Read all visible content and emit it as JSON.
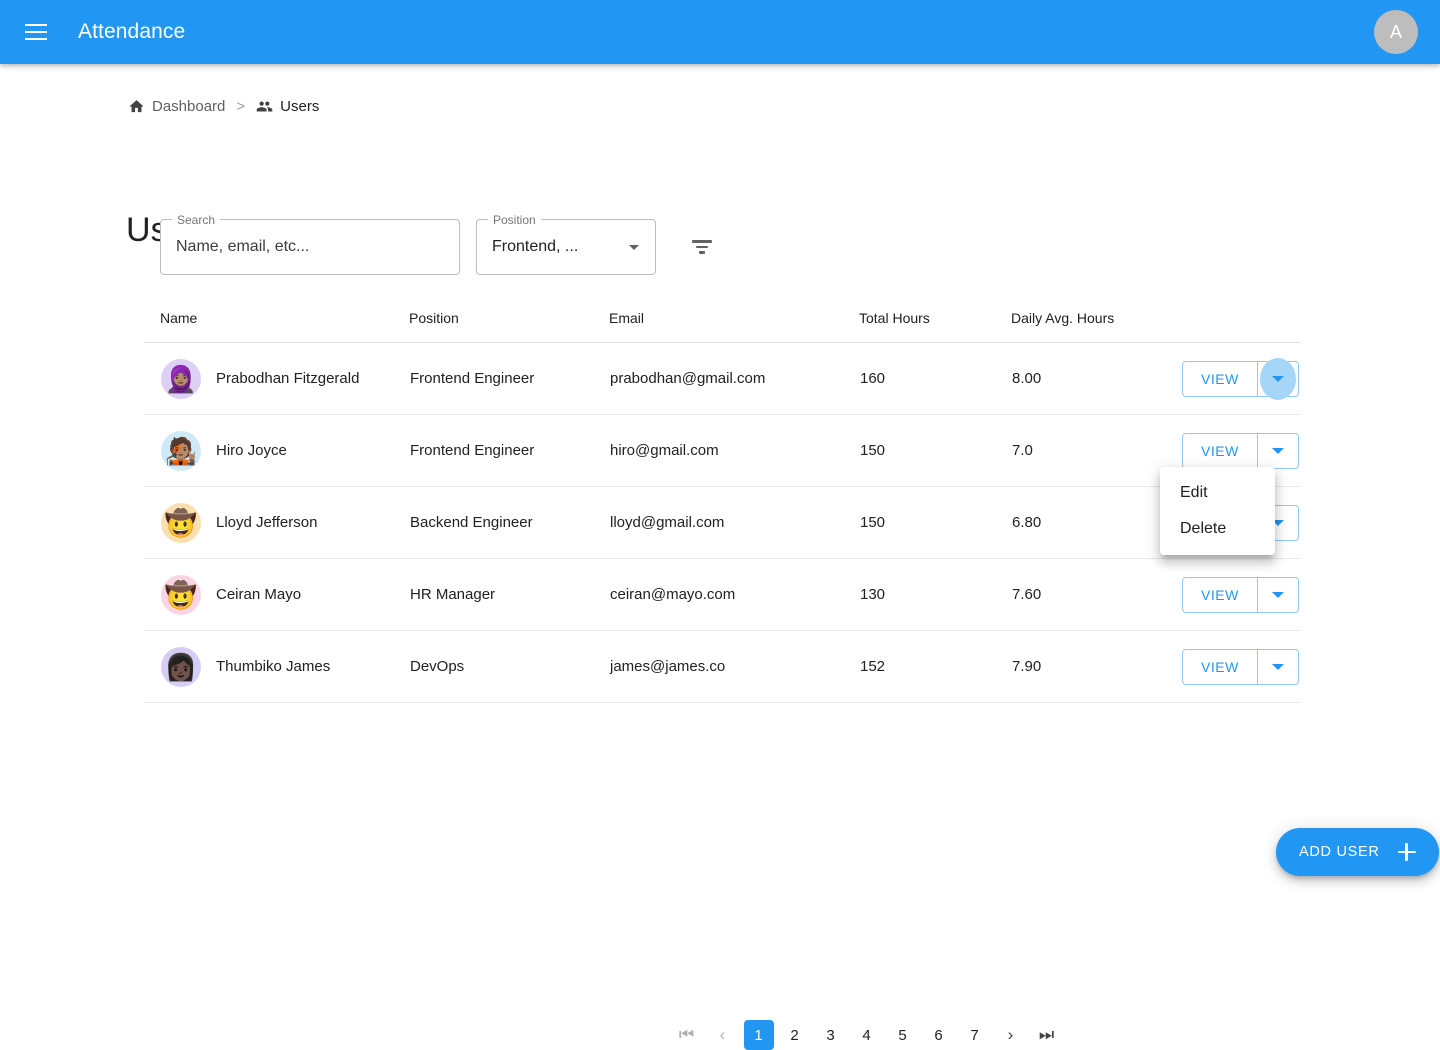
{
  "appbar": {
    "title": "Attendance",
    "menu_icon": "hamburger-menu-icon",
    "avatar_initial": "A",
    "background_color": "#2196f3"
  },
  "breadcrumb": {
    "items": [
      {
        "label": "Dashboard",
        "icon": "home-icon"
      },
      {
        "label": "Users",
        "icon": "people-icon"
      }
    ],
    "separator": ">"
  },
  "page": {
    "title": "Users"
  },
  "filters": {
    "search": {
      "legend": "Search",
      "value": "",
      "placeholder": "Name, email, etc..."
    },
    "position": {
      "legend": "Position",
      "value": "Frontend, ...",
      "icon": "chevron-down-icon"
    },
    "filter_button": {
      "icon": "filter-list-icon"
    }
  },
  "table": {
    "columns": [
      "Name",
      "Position",
      "Email",
      "Total Hours",
      "Daily Avg. Hours",
      ""
    ],
    "rows": [
      {
        "avatar": {
          "emoji": "🧕🏽",
          "bg": "#ddd0f5"
        },
        "name": "Prabodhan Fitzgerald",
        "position": "Frontend Engineer",
        "email": "prabodhan@gmail.com",
        "total_hours": "160",
        "daily_avg_hours": "8.00",
        "view_label": "VIEW",
        "menu_open": true
      },
      {
        "avatar": {
          "emoji": "🧑🏽‍🎤",
          "bg": "#cfeaf7"
        },
        "name": "Hiro Joyce",
        "position": "Frontend Engineer",
        "email": "hiro@gmail.com",
        "total_hours": "150",
        "daily_avg_hours": "7.0",
        "view_label": "VIEW",
        "menu_open": false
      },
      {
        "avatar": {
          "emoji": "🤠",
          "bg": "#fbdfae"
        },
        "name": "Lloyd Jefferson",
        "position": "Backend Engineer",
        "email": "lloyd@gmail.com",
        "total_hours": "150",
        "daily_avg_hours": "6.80",
        "view_label": "VIEW",
        "menu_open": false
      },
      {
        "avatar": {
          "emoji": "🤠",
          "bg": "#fbd4e4"
        },
        "name": "Ceiran Mayo",
        "position": "HR Manager",
        "email": "ceiran@mayo.com",
        "total_hours": "130",
        "daily_avg_hours": "7.60",
        "view_label": "VIEW",
        "menu_open": false
      },
      {
        "avatar": {
          "emoji": "👩🏿",
          "bg": "#d6cdf5"
        },
        "name": "Thumbiko James",
        "position": "DevOps",
        "email": "james@james.co",
        "total_hours": "152",
        "daily_avg_hours": "7.90",
        "view_label": "VIEW",
        "menu_open": false
      }
    ]
  },
  "row_menu": {
    "items": [
      "Edit",
      "Delete"
    ]
  },
  "pagination": {
    "first_icon": "first-page-icon",
    "prev_icon": "chevron-left-icon",
    "pages": [
      "1",
      "2",
      "3",
      "4",
      "5",
      "6",
      "7"
    ],
    "current_page": "1",
    "next_icon": "chevron-right-icon",
    "last_icon": "last-page-icon"
  },
  "fab": {
    "label": "ADD USER",
    "icon": "plus-icon",
    "color": "#2196f3"
  }
}
